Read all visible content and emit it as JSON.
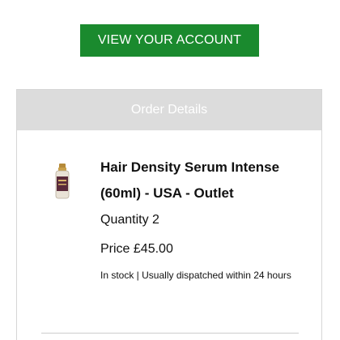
{
  "header": {
    "account_button_label": "VIEW YOUR ACCOUNT"
  },
  "order": {
    "title": "Order Details",
    "item": {
      "name": "Hair Density Serum Intense (60ml) - USA - Outlet",
      "quantity_text": "Quantity 2",
      "price_text": "Price £45.00",
      "stock_text": "In stock | Usually dispatched within 24 hours",
      "thumbnail_icon": "product-bottle-icon"
    }
  },
  "colors": {
    "button_green": "#1a8a2e",
    "header_grey": "#dcdcdc"
  }
}
